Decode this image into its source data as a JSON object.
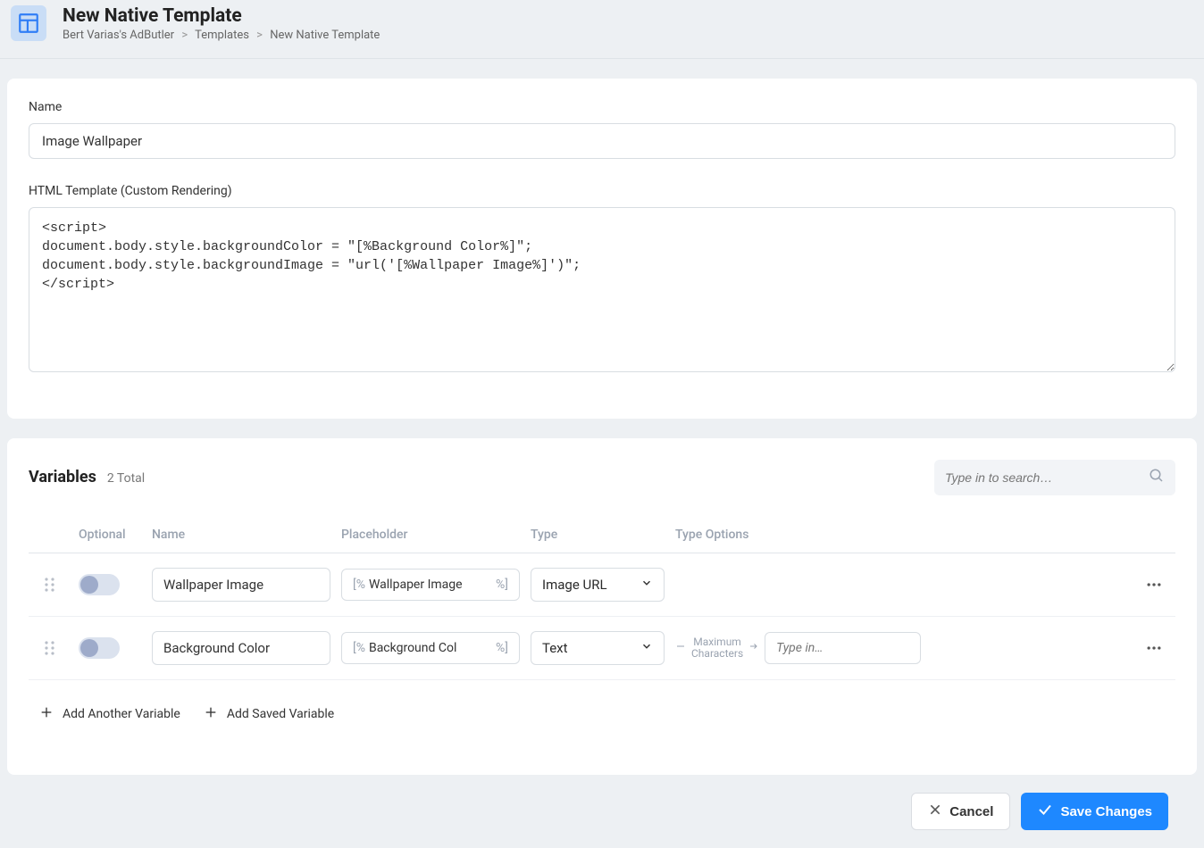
{
  "header": {
    "title": "New Native Template",
    "breadcrumb": [
      "Bert Varias's AdButler",
      "Templates",
      "New Native Template"
    ]
  },
  "form": {
    "name_label": "Name",
    "name_value": "Image Wallpaper",
    "html_label": "HTML Template (Custom Rendering)",
    "html_value": "<script>\ndocument.body.style.backgroundColor = \"[%Background Color%]\";\ndocument.body.style.backgroundImage = \"url('[%Wallpaper Image%]')\";\n</script>"
  },
  "variables": {
    "title": "Variables",
    "count_text": "2 Total",
    "search_placeholder": "Type in to search…",
    "columns": {
      "optional": "Optional",
      "name": "Name",
      "placeholder": "Placeholder",
      "type": "Type",
      "type_options": "Type Options"
    },
    "rows": [
      {
        "name": "Wallpaper Image",
        "placeholder_text": "Wallpaper Image",
        "type": "Image URL",
        "type_options": null
      },
      {
        "name": "Background Color",
        "placeholder_text": "Background Col",
        "type": "Text",
        "type_options": {
          "label": "Maximum\nCharacters",
          "input_placeholder": "Type in…"
        }
      }
    ],
    "bracket_open": "[%",
    "bracket_close": "%]",
    "add_another": "Add Another Variable",
    "add_saved": "Add Saved Variable"
  },
  "footer": {
    "cancel": "Cancel",
    "save": "Save Changes"
  }
}
